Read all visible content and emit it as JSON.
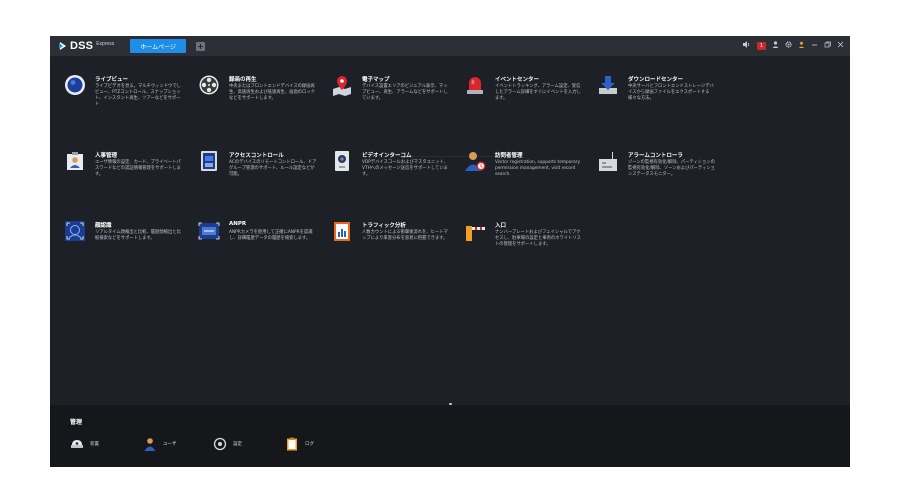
{
  "app": {
    "logo_text": "DSS",
    "logo_sub": "Express",
    "home_tab": "ホームページ",
    "add_tab_symbol": "+",
    "alarm_count": "1",
    "accent_color": "#1e8ee9"
  },
  "modules": [
    {
      "title": "ライブビュー",
      "desc": "ライブビデオを見る。マルチウィンドウでしビュー、PTZコントロール、スナップショット、インスタント再生、ツアーなどをサポート"
    },
    {
      "title": "録画の再生",
      "desc": "中央またはフロントエンドデバイスの録画再生、高速再生および低速再生、画面のロックなどをサポートします。"
    },
    {
      "title": "電子マップ",
      "desc": "デバイス設置エリアのビジュアル表示、マップビュー、再生、アラームなどをサポートしています。"
    },
    {
      "title": "イベントセンター",
      "desc": "イベントトラッキング、アラーム設定、受信したアラーム詳細をすぐにイベントを入力します。"
    },
    {
      "title": "ダウンロードセンター",
      "desc": "中央サーバとフロントエンドストレージデバイスから録画ファイルをエクスポートする様々な方法。"
    },
    {
      "title": "人事管理",
      "desc": "ユーザ情報の設定、カード、プライベートパスワードなどの認証情報管理をサポートします。"
    },
    {
      "title": "アクセスコントロール",
      "desc": "ACのデバイスのリモートコントロール、ドアグループ管理のサポート、ルール設定などが可能。"
    },
    {
      "title": "ビデオインターコム",
      "desc": "VDPデバイスコールおよびマスタユニット、VTHへのメッセージ送信をサポートしています。"
    },
    {
      "title": "訪問者管理",
      "desc": "Visitor registration, supports temporary permission management, visit record search."
    },
    {
      "title": "アラームコントローラ",
      "desc": "ゾーンの監視有効化/解除、パーティションの監視有効化/解除、ゾーンおよびパーティションステータスモニター。"
    },
    {
      "title": "顔認識",
      "desc": "リアルタイム顔検出と比較、履歴顔検出と比較検索などをサポートします。"
    },
    {
      "title": "ANPR",
      "desc": "ANPRカメラを使用して正確にANPRを認識し、詳細履歴データの履歴を検索します。"
    },
    {
      "title": "トラフィック分析",
      "desc": "人数カウントによる衝撃後流れを、ヒートマップにより来客分布を容易に把握できます。"
    },
    {
      "title": "入口",
      "desc": "ナンバープレートおよびフェイシャルでアクセスし、駐車場の設定と車両のホワイトリストの管理をサポートします。"
    }
  ],
  "management": {
    "title": "管理",
    "items": [
      {
        "label": "装置"
      },
      {
        "label": "ユーザ"
      },
      {
        "label": "設定"
      },
      {
        "label": "ログ"
      }
    ]
  }
}
